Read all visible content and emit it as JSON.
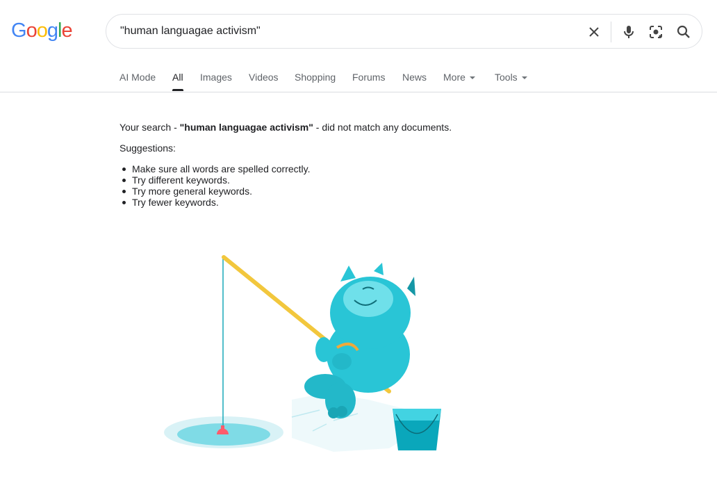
{
  "logo": {
    "letters": [
      "G",
      "o",
      "o",
      "g",
      "l",
      "e"
    ],
    "colors": [
      "#4285F4",
      "#EA4335",
      "#FBBC05",
      "#4285F4",
      "#34A853",
      "#EA4335"
    ]
  },
  "search": {
    "query": "\"human languagae activism\""
  },
  "tabs": [
    {
      "label": "AI Mode"
    },
    {
      "label": "All",
      "active": true
    },
    {
      "label": "Images"
    },
    {
      "label": "Videos"
    },
    {
      "label": "Shopping"
    },
    {
      "label": "Forums"
    },
    {
      "label": "News"
    },
    {
      "label": "More"
    },
    {
      "label": "Tools"
    }
  ],
  "result": {
    "prefix": "Your search - ",
    "query": "\"human languagae activism\"",
    "suffix": " - did not match any documents.",
    "suggestions_label": "Suggestions:",
    "suggestions": [
      "Make sure all words are spelled correctly.",
      "Try different keywords.",
      "Try more general keywords.",
      "Try fewer keywords."
    ]
  },
  "icons": {
    "clear": "close-icon",
    "voice": "microphone-icon",
    "lens": "camera-lens-icon",
    "search": "search-icon"
  }
}
